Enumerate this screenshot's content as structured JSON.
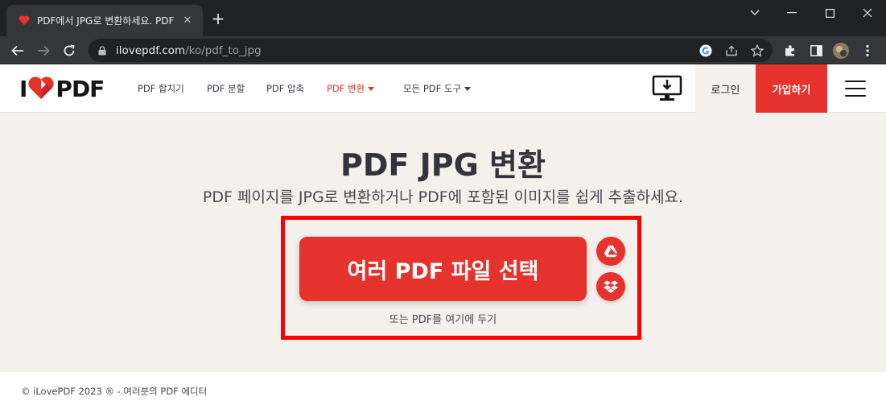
{
  "browser": {
    "tab_title": "PDF에서 JPG로 변환하세요. PDF",
    "new_tab": "+",
    "url_host": "ilovepdf.com",
    "url_path": "/ko/pdf_to_jpg"
  },
  "header": {
    "logo_left": "I",
    "logo_right": "PDF",
    "nav": [
      {
        "label": "PDF 합치기"
      },
      {
        "label": "PDF 분할"
      },
      {
        "label": "PDF 압축"
      },
      {
        "label": "PDF 변환"
      },
      {
        "label": "모든 PDF 도구"
      }
    ],
    "login": "로그인",
    "signup": "가입하기"
  },
  "main": {
    "title": "PDF JPG 변환",
    "subtitle": "PDF 페이지를 JPG로 변환하거나 PDF에 포함된 이미지를 쉽게 추출하세요.",
    "select_button": "여러 PDF 파일 선택",
    "drop_hint": "또는 PDF를 여기에 두기"
  },
  "footer": {
    "text": "© iLovePDF 2023 ® - 여러분의 PDF 에디터"
  },
  "colors": {
    "brand_red": "#e5322d",
    "highlight": "#ff0000",
    "background": "#f4f0ec",
    "chrome_dark": "#202124"
  }
}
